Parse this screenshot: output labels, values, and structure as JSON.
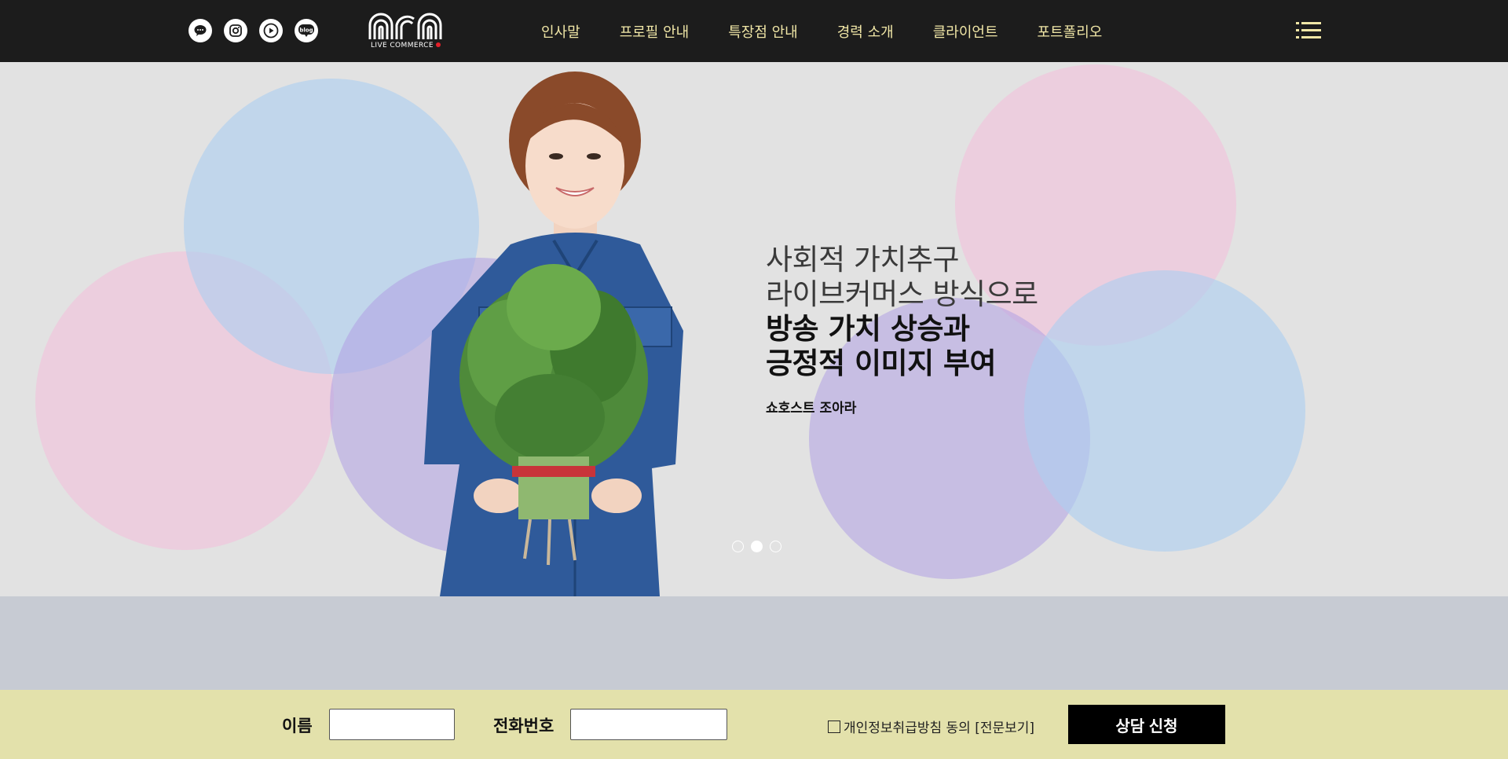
{
  "header": {
    "social_icons": [
      "kakaotalk-icon",
      "instagram-icon",
      "youtube-icon",
      "blog-icon"
    ],
    "social_blog_text": "blog",
    "logo_text": "ara",
    "logo_subtitle": "LIVE COMMERCE",
    "nav": [
      {
        "label": "인사말"
      },
      {
        "label": "프로필 안내"
      },
      {
        "label": "특장점 안내"
      },
      {
        "label": "경력 소개"
      },
      {
        "label": "클라이언트"
      },
      {
        "label": "포트폴리오"
      }
    ],
    "menu_icon": "hamburger-menu-icon"
  },
  "hero": {
    "line1": "사회적 가치추구",
    "line2": "라이브커머스 방식으로",
    "line3": "방송 가치 상승과",
    "line4": "긍정적 이미지 부여",
    "host": "쇼호스트 조아라",
    "slides": {
      "count": 3,
      "active": 2
    }
  },
  "form": {
    "name_label": "이름",
    "name_value": "",
    "phone_label": "전화번호",
    "phone_value": "",
    "agree_label": "개인정보취급방침 동의 [전문보기]",
    "submit_label": "상담 신청"
  },
  "colors": {
    "header_bg": "#1c1c1c",
    "nav_text": "#f0e6a6",
    "hero_bg": "#e2e2e2",
    "form_bg": "#e3e1ab",
    "band_bg": "#c7cbd3",
    "submit_bg": "#000000"
  }
}
